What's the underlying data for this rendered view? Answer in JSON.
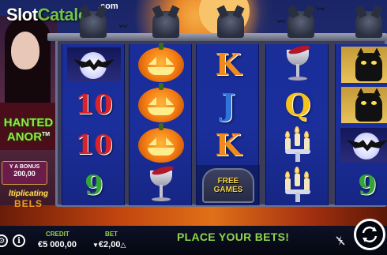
{
  "branding": {
    "site_logo_part1": "Slot",
    "site_logo_part2": "Catalog",
    "site_logo_suffix": ".com",
    "game_title_line1": "HANTED",
    "game_title_line2": "ANOR",
    "game_title_tm": "TM"
  },
  "side_panel": {
    "buy_bonus_label": "Y A BONUS",
    "buy_bonus_price": "200,00",
    "feature_line1": "ltiplicating",
    "feature_line2": "BELS"
  },
  "reels": [
    {
      "symbols": [
        {
          "type": "bat-moon"
        },
        {
          "type": "number",
          "text": "10",
          "color": "red"
        },
        {
          "type": "number",
          "text": "10",
          "color": "red"
        },
        {
          "type": "number",
          "text": "9",
          "color": "green"
        }
      ]
    },
    {
      "symbols": [
        {
          "type": "pumpkin"
        },
        {
          "type": "pumpkin"
        },
        {
          "type": "pumpkin"
        },
        {
          "type": "goblet"
        }
      ]
    },
    {
      "symbols": [
        {
          "type": "letter",
          "text": "K",
          "color": "orange"
        },
        {
          "type": "letter",
          "text": "J",
          "color": "blue"
        },
        {
          "type": "letter",
          "text": "K",
          "color": "orange"
        },
        {
          "type": "free-games",
          "text_line1": "FREE",
          "text_line2": "GAMES"
        }
      ]
    },
    {
      "symbols": [
        {
          "type": "goblet"
        },
        {
          "type": "letter",
          "text": "Q",
          "color": "yellow"
        },
        {
          "type": "candles"
        },
        {
          "type": "candles"
        }
      ]
    },
    {
      "symbols": [
        {
          "type": "cat"
        },
        {
          "type": "cat"
        },
        {
          "type": "bat-moon"
        },
        {
          "type": "number",
          "text": "9",
          "color": "green"
        }
      ]
    }
  ],
  "controls": {
    "settings_icon": "gear-icon",
    "info_icon_text": "i",
    "credit_label": "CREDIT",
    "credit_value": "€5 000,00",
    "bet_label": "BET",
    "bet_value": "€2,00",
    "bet_decrease_icon": "▼",
    "bet_increase_icon": "△",
    "status_message": "PLACE YOUR BETS!",
    "turbo_icon": "lightning-icon",
    "spin_icon": "spin-arrows-icon"
  },
  "colors": {
    "accent_green": "#8fd64a",
    "reel_blue": "#1b2f9c",
    "red_symbol": "#d8232a",
    "green_symbol": "#35a33a",
    "orange_symbol": "#f08a1c",
    "blue_symbol": "#2f74d8",
    "yellow_symbol": "#f5c21a"
  }
}
